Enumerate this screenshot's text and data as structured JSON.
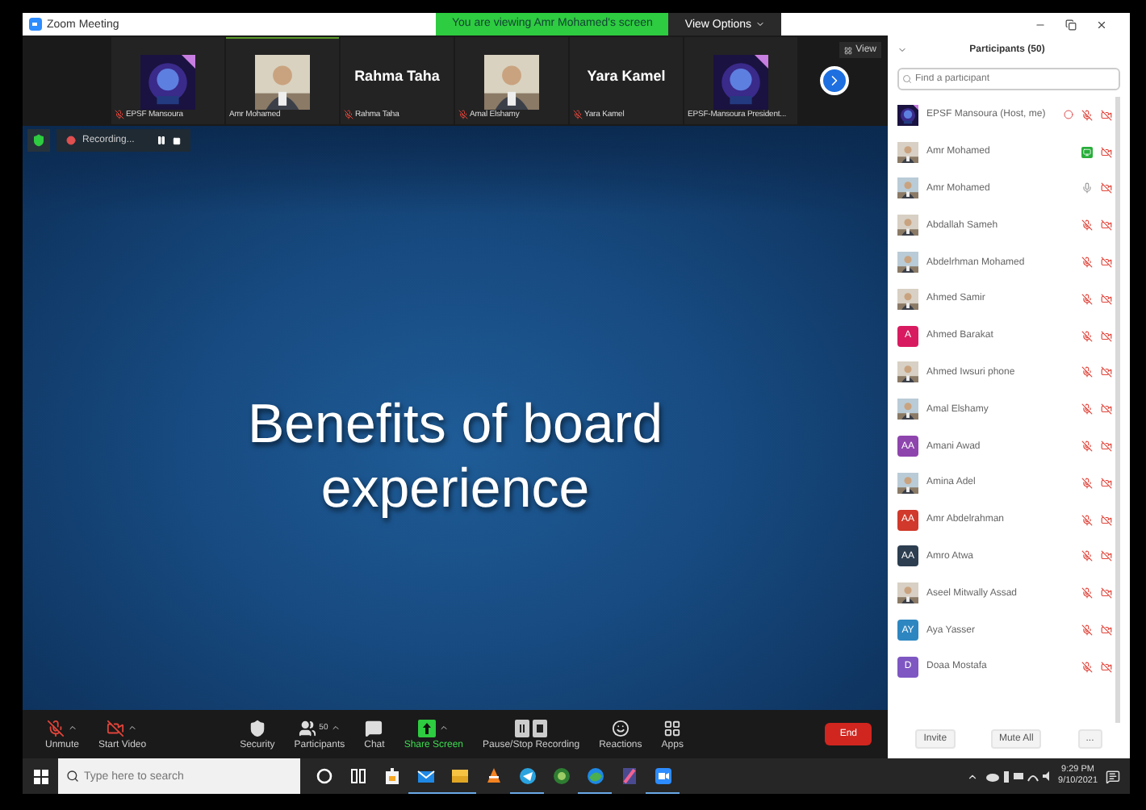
{
  "window": {
    "title": "Zoom Meeting"
  },
  "banner": {
    "text": "You are viewing Amr Mohamed's screen",
    "options": "View Options"
  },
  "gallery": {
    "view": "View",
    "tiles": [
      {
        "name": "EPSF Mansoura",
        "muted": true,
        "active": false
      },
      {
        "name": "Amr Mohamed",
        "muted": false,
        "active": true
      },
      {
        "name": "Rahma Taha",
        "kind": "name",
        "display_name": "Rahma Taha",
        "muted": true,
        "active": false
      },
      {
        "name": "Amal Elshamy",
        "muted": true,
        "active": false
      },
      {
        "name": "Yara Kamel",
        "kind": "name",
        "display_name": "Yara Kamel",
        "muted": true,
        "active": false
      },
      {
        "name": "EPSF-Mansoura President...",
        "muted": false,
        "active": false
      }
    ]
  },
  "recording": {
    "label": "Recording..."
  },
  "slide": {
    "title": "Benefits of board experience"
  },
  "toolbar": [
    {
      "kind": "unmute",
      "label": "Unmute",
      "menu": true
    },
    {
      "kind": "video",
      "label": "Start Video",
      "menu": true
    },
    {
      "kind": "security",
      "label": "Security",
      "menu": false
    },
    {
      "kind": "participants",
      "label": "Participants",
      "count": "50",
      "menu": true
    },
    {
      "kind": "chat",
      "label": "Chat",
      "menu": false
    },
    {
      "kind": "share",
      "label": "Share Screen",
      "menu": true
    },
    {
      "kind": "recording",
      "label": "Pause/Stop Recording",
      "menu": false
    },
    {
      "kind": "reactions",
      "label": "Reactions",
      "menu": false
    },
    {
      "kind": "apps",
      "label": "Apps",
      "menu": false
    }
  ],
  "end_button": "End",
  "participants": {
    "title": "Participants (50)",
    "search": {
      "placeholder": "Find a participant"
    },
    "items": [
      {
        "name": "EPSF Mansoura (Host, me)",
        "recording": true,
        "sharing": false,
        "muted": true,
        "video": false
      },
      {
        "name": "Amr Mohamed",
        "recording": false,
        "sharing": true,
        "muted": false,
        "video": false
      },
      {
        "name": "Amr Mohamed",
        "recording": false,
        "sharing": false,
        "muted": false,
        "video": false
      },
      {
        "name": "Abdallah Sameh",
        "recording": false,
        "sharing": false,
        "muted": true,
        "video": false
      },
      {
        "name": "Abdelrhman Mohamed",
        "recording": false,
        "sharing": false,
        "muted": true,
        "video": false
      },
      {
        "name": "Ahmed Samir",
        "recording": false,
        "sharing": false,
        "muted": true,
        "video": false
      },
      {
        "name": "Ahmed Barakat",
        "kind": "initials",
        "initials": "A",
        "color": "#d81b60",
        "recording": false,
        "sharing": false,
        "muted": true,
        "video": false
      },
      {
        "name": "Ahmed Iwsuri phone",
        "recording": false,
        "sharing": false,
        "muted": true,
        "video": false
      },
      {
        "name": "Amal Elshamy",
        "recording": false,
        "sharing": false,
        "muted": true,
        "video": false
      },
      {
        "name": "Amani Awad",
        "kind": "initials",
        "initials": "AA",
        "color": "#8e44ad",
        "recording": false,
        "sharing": false,
        "muted": true,
        "video": false
      },
      {
        "name": "Amina Adel",
        "recording": false,
        "sharing": false,
        "muted": true,
        "video": false
      },
      {
        "name": "Amr Abdelrahman",
        "kind": "initials",
        "initials": "AA",
        "color": "#d0392b",
        "recording": false,
        "sharing": false,
        "muted": true,
        "video": false
      },
      {
        "name": "Amro Atwa",
        "kind": "initials",
        "initials": "AA",
        "color": "#2c3e50",
        "recording": false,
        "sharing": false,
        "muted": true,
        "video": false
      },
      {
        "name": "Aseel Mitwally Assad",
        "recording": false,
        "sharing": false,
        "muted": true,
        "video": false
      },
      {
        "name": "Aya Yasser",
        "kind": "initials",
        "initials": "AY",
        "color": "#2e86c1",
        "recording": false,
        "sharing": false,
        "muted": true,
        "video": false
      },
      {
        "name": "Doaa Mostafa",
        "kind": "initials",
        "initials": "D",
        "color": "#7e57c2",
        "recording": false,
        "sharing": false,
        "muted": true,
        "video": false
      }
    ],
    "buttons": [
      "Invite",
      "Mute All",
      "..."
    ]
  },
  "taskbar": {
    "search": {
      "placeholder": "Type here to search"
    },
    "apps": [
      {
        "kind": "cortana",
        "running": false
      },
      {
        "kind": "taskview",
        "running": false
      },
      {
        "kind": "store",
        "running": false
      },
      {
        "kind": "mail",
        "running": true
      },
      {
        "kind": "explorer",
        "running": true
      },
      {
        "kind": "vlc",
        "running": false
      },
      {
        "kind": "telegram",
        "running": true
      },
      {
        "kind": "ring",
        "running": false
      },
      {
        "kind": "edge",
        "running": true
      },
      {
        "kind": "paint",
        "running": false
      },
      {
        "kind": "zoom",
        "running": true
      }
    ],
    "time": "9:29 PM",
    "date": "9/10/2021"
  }
}
